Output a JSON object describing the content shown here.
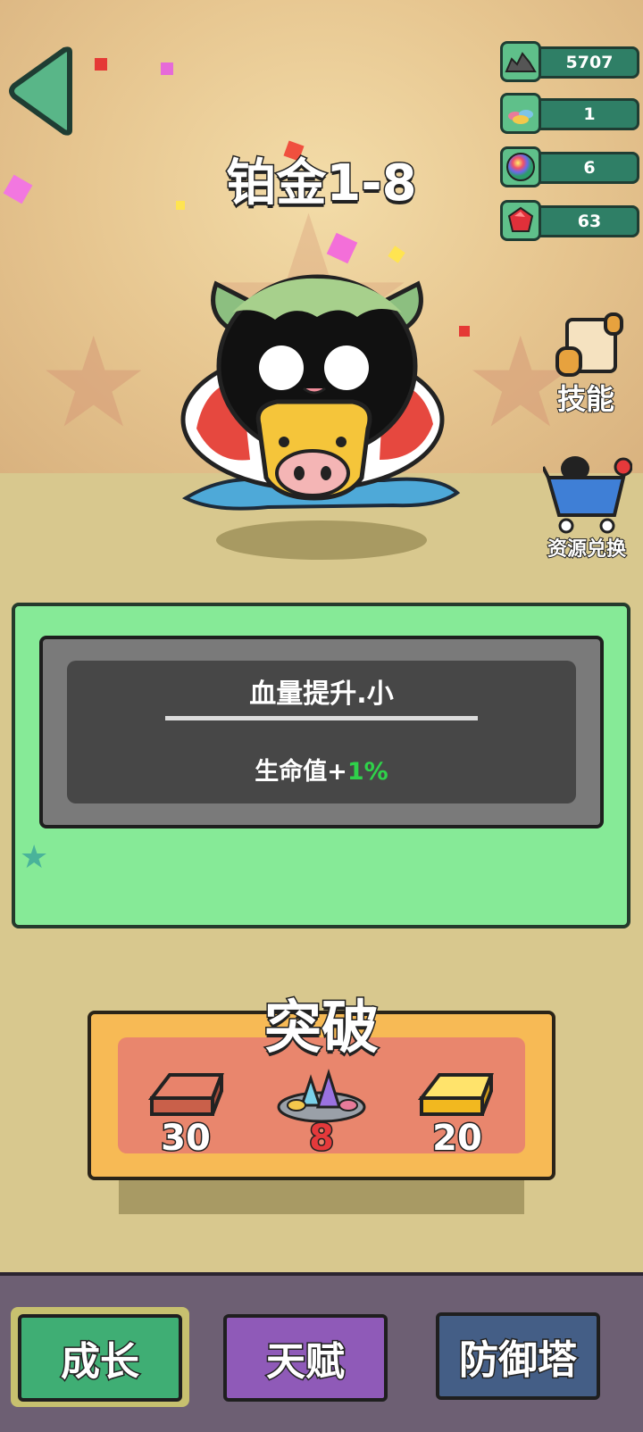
{
  "header": {
    "back_label": "back"
  },
  "resources": [
    {
      "name": "ore",
      "icon": "ore-pile-icon",
      "value": "5707"
    },
    {
      "name": "gems",
      "icon": "gem-pile-icon",
      "value": "1"
    },
    {
      "name": "orb",
      "icon": "rainbow-orb-icon",
      "value": "6"
    },
    {
      "name": "ruby",
      "icon": "ruby-icon",
      "value": "63"
    }
  ],
  "stage": {
    "title": "铂金1-8"
  },
  "side_menu": {
    "skill_label": "技能",
    "exchange_label": "资源兑换"
  },
  "upgrade_card": {
    "name": "血量提升.小",
    "effect_prefix": "生命值+",
    "effect_value": "1%"
  },
  "breakthrough": {
    "title": "突破",
    "costs": [
      {
        "item": "copper-bar-icon",
        "amount": "30",
        "color": "#ffffff"
      },
      {
        "item": "gem-pile-icon",
        "amount": "8",
        "color": "#e5393b"
      },
      {
        "item": "gold-bar-icon",
        "amount": "20",
        "color": "#ffffff"
      }
    ]
  },
  "tabs": [
    {
      "label": "成长",
      "color": "#3fae74",
      "active": true
    },
    {
      "label": "天赋",
      "color": "#8f5ab8",
      "active": false
    },
    {
      "label": "防御塔",
      "color": "#445e86",
      "active": false
    }
  ]
}
